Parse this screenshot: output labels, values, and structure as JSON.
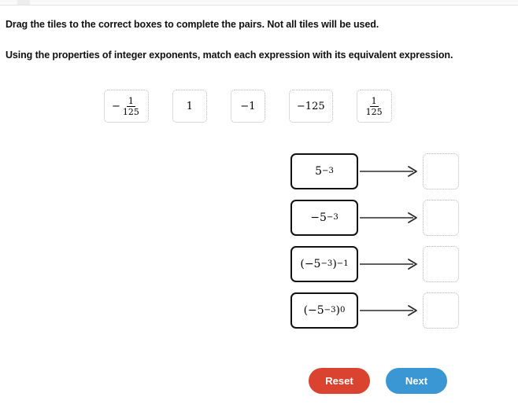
{
  "instructions": {
    "line1": "Drag the tiles to the correct boxes to complete the pairs. Not all tiles will be used.",
    "line2": "Using the properties of integer exponents, match each expression with its equivalent expression."
  },
  "tiles": [
    {
      "id": "tile-neg-one-over-125",
      "display": "−1/125",
      "sign": "−",
      "numerator": "1",
      "denominator": "125",
      "kind": "fraction"
    },
    {
      "id": "tile-one",
      "display": "1",
      "kind": "plain"
    },
    {
      "id": "tile-neg-one",
      "display": "−1",
      "kind": "plain"
    },
    {
      "id": "tile-neg-125",
      "display": "−125",
      "kind": "plain"
    },
    {
      "id": "tile-one-over-125",
      "display": "1/125",
      "sign": "",
      "numerator": "1",
      "denominator": "125",
      "kind": "fraction"
    }
  ],
  "match_rows": [
    {
      "id": "row-1",
      "base": "5",
      "exponent": "−3",
      "expression": "5⁻³",
      "drop_value": ""
    },
    {
      "id": "row-2",
      "base": "−5",
      "exponent": "−3",
      "expression": "−5⁻³",
      "drop_value": ""
    },
    {
      "id": "row-3",
      "base": "(−5",
      "exponent": "−3",
      "outer_exponent": "−1",
      "expression": "(−5⁻³)⁻¹",
      "drop_value": ""
    },
    {
      "id": "row-4",
      "base": "(−5",
      "exponent": "−3",
      "outer_exponent": "0",
      "expression": "(−5⁻³)⁰",
      "drop_value": ""
    }
  ],
  "buttons": {
    "reset_label": "Reset",
    "next_label": "Next"
  },
  "colors": {
    "reset_bg": "#d9432f",
    "next_bg": "#3b97d3",
    "text": "#111111",
    "tile_border": "#b6b6b6",
    "expr_border": "#111111",
    "divider": "#e3e3e3"
  }
}
